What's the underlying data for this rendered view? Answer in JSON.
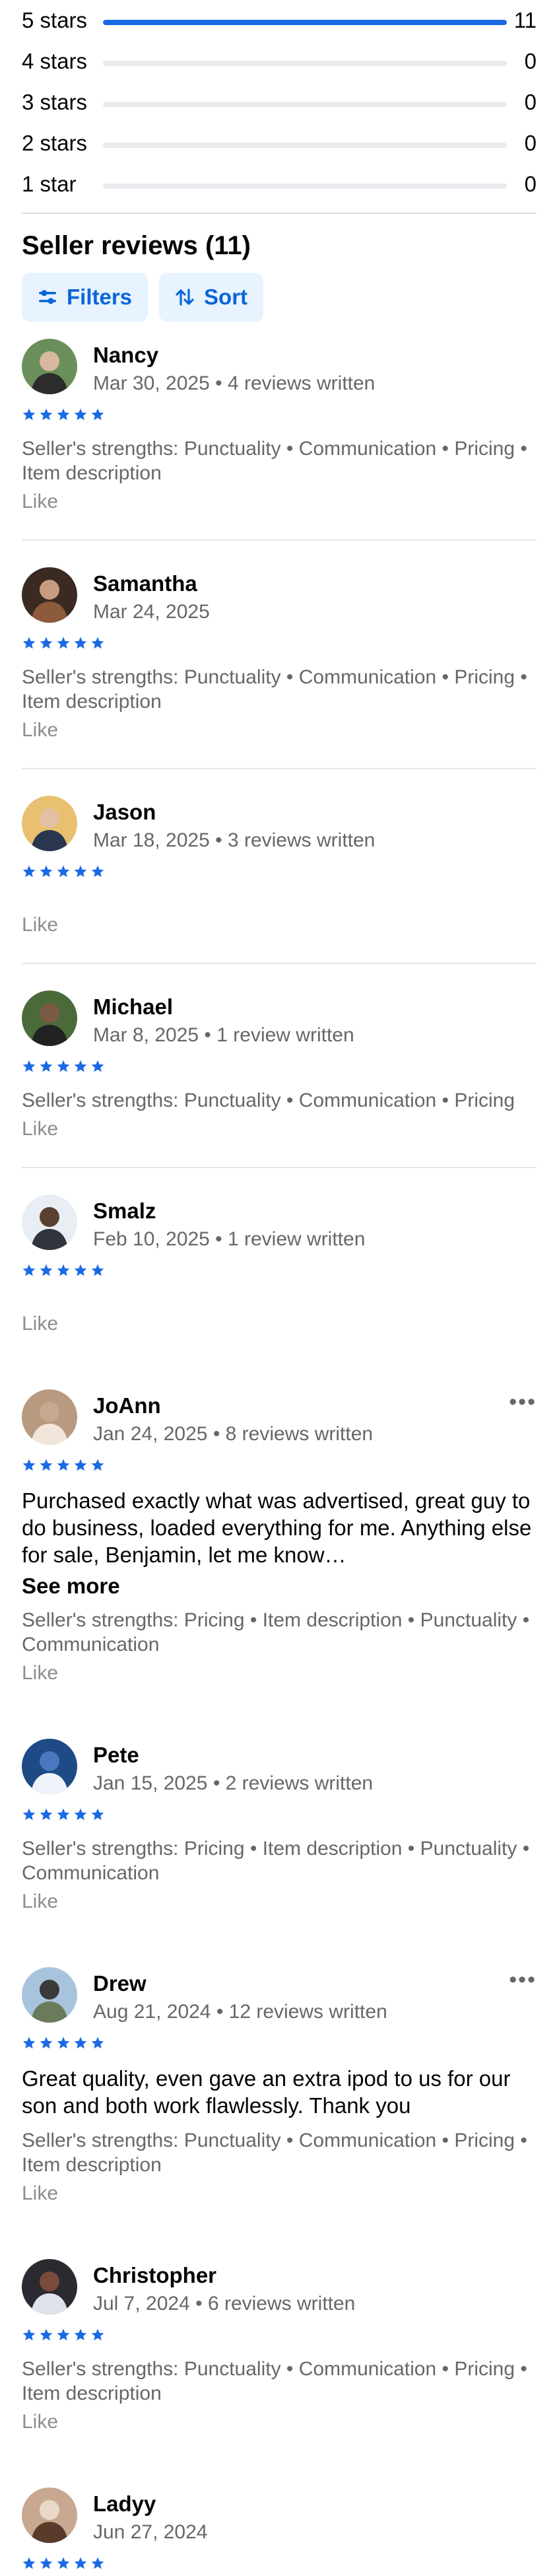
{
  "distribution": [
    {
      "label": "5 stars",
      "count": "11",
      "fraction": 1.0
    },
    {
      "label": "4 stars",
      "count": "0",
      "fraction": 0
    },
    {
      "label": "3 stars",
      "count": "0",
      "fraction": 0
    },
    {
      "label": "2 stars",
      "count": "0",
      "fraction": 0
    },
    {
      "label": "1 star",
      "count": "0",
      "fraction": 0
    }
  ],
  "section_title": "Seller reviews (11)",
  "buttons": {
    "filters": "Filters",
    "sort": "Sort"
  },
  "colors": {
    "accent": "#1a6ae3",
    "pill_bg": "#e7f3ff",
    "star": "#1a6ae3"
  },
  "reviews": [
    {
      "name": "Nancy",
      "meta": "Mar 30, 2025 • 4 reviews written",
      "stars": 5,
      "text": "",
      "see_more": "",
      "strengths": "Seller's strengths: Punctuality • Communication • Pricing • Item description",
      "like": "Like",
      "more": ""
    },
    {
      "name": "Samantha",
      "meta": "Mar 24, 2025",
      "stars": 5,
      "text": "",
      "see_more": "",
      "strengths": "Seller's strengths: Punctuality • Communication • Pricing • Item description",
      "like": "Like",
      "more": ""
    },
    {
      "name": "Jason",
      "meta": "Mar 18, 2025 • 3 reviews written",
      "stars": 5,
      "text": "",
      "see_more": "",
      "strengths": "",
      "like": "Like",
      "more": ""
    },
    {
      "name": "Michael",
      "meta": "Mar 8, 2025 • 1 review written",
      "stars": 5,
      "text": "",
      "see_more": "",
      "strengths": "Seller's strengths: Punctuality • Communication • Pricing",
      "like": "Like",
      "more": ""
    },
    {
      "name": "Smalz",
      "meta": "Feb 10, 2025 • 1 review written",
      "stars": 5,
      "text": "",
      "see_more": "",
      "strengths": "",
      "like": "Like",
      "more": ""
    },
    {
      "name": "JoAnn",
      "meta": "Jan 24, 2025 • 8 reviews written",
      "stars": 5,
      "text": "Purchased exactly what was advertised, great guy to do business, loaded everything for me. Anything else for sale, Benjamin, let me know…",
      "see_more": "See more",
      "strengths": "Seller's strengths: Pricing • Item description • Punctuality • Communication",
      "like": "Like",
      "more": "•••"
    },
    {
      "name": "Pete",
      "meta": "Jan 15, 2025 • 2 reviews written",
      "stars": 5,
      "text": "",
      "see_more": "",
      "strengths": "Seller's strengths: Pricing • Item description • Punctuality • Communication",
      "like": "Like",
      "more": ""
    },
    {
      "name": "Drew",
      "meta": "Aug 21, 2024 • 12 reviews written",
      "stars": 5,
      "text": "Great quality, even gave an extra ipod to us for our son and both work flawlessly. Thank you",
      "see_more": "",
      "strengths": "Seller's strengths: Punctuality • Communication • Pricing • Item description",
      "like": "Like",
      "more": "•••"
    },
    {
      "name": "Christopher",
      "meta": "Jul 7, 2024 • 6 reviews written",
      "stars": 5,
      "text": "",
      "see_more": "",
      "strengths": "Seller's strengths: Punctuality • Communication • Pricing • Item description",
      "like": "Like",
      "more": ""
    },
    {
      "name": "Ladyy",
      "meta": "Jun 27, 2024",
      "stars": 5,
      "text": "",
      "see_more": "",
      "strengths": "",
      "like": "",
      "more": ""
    }
  ]
}
